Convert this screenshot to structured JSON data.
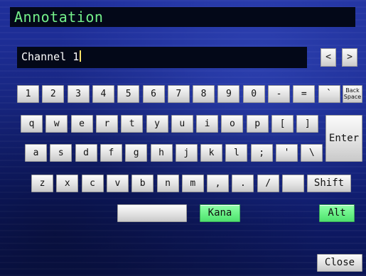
{
  "title": "Annotation",
  "input": {
    "value": "Channel 1"
  },
  "nav": {
    "prev": "<",
    "next": ">"
  },
  "keyboard": {
    "row1": [
      "1",
      "2",
      "3",
      "4",
      "5",
      "6",
      "7",
      "8",
      "9",
      "0",
      "-",
      "=",
      "`"
    ],
    "backspace": [
      "Back",
      "Space"
    ],
    "row2": [
      "q",
      "w",
      "e",
      "r",
      "t",
      "y",
      "u",
      "i",
      "o",
      "p",
      "[",
      "]"
    ],
    "enter": "Enter",
    "row3": [
      "a",
      "s",
      "d",
      "f",
      "g",
      "h",
      "j",
      "k",
      "l",
      ";",
      "'",
      "\\"
    ],
    "row4": [
      "z",
      "x",
      "c",
      "v",
      "b",
      "n",
      "m",
      ",",
      ".",
      "/",
      ""
    ],
    "shift": "Shift",
    "space": "",
    "kana": "Kana",
    "alt": "Alt",
    "close": "Close"
  },
  "colors": {
    "accent_green": "#66f083",
    "title_green": "#74f08a",
    "bg_blue": "#1a2a8f"
  }
}
